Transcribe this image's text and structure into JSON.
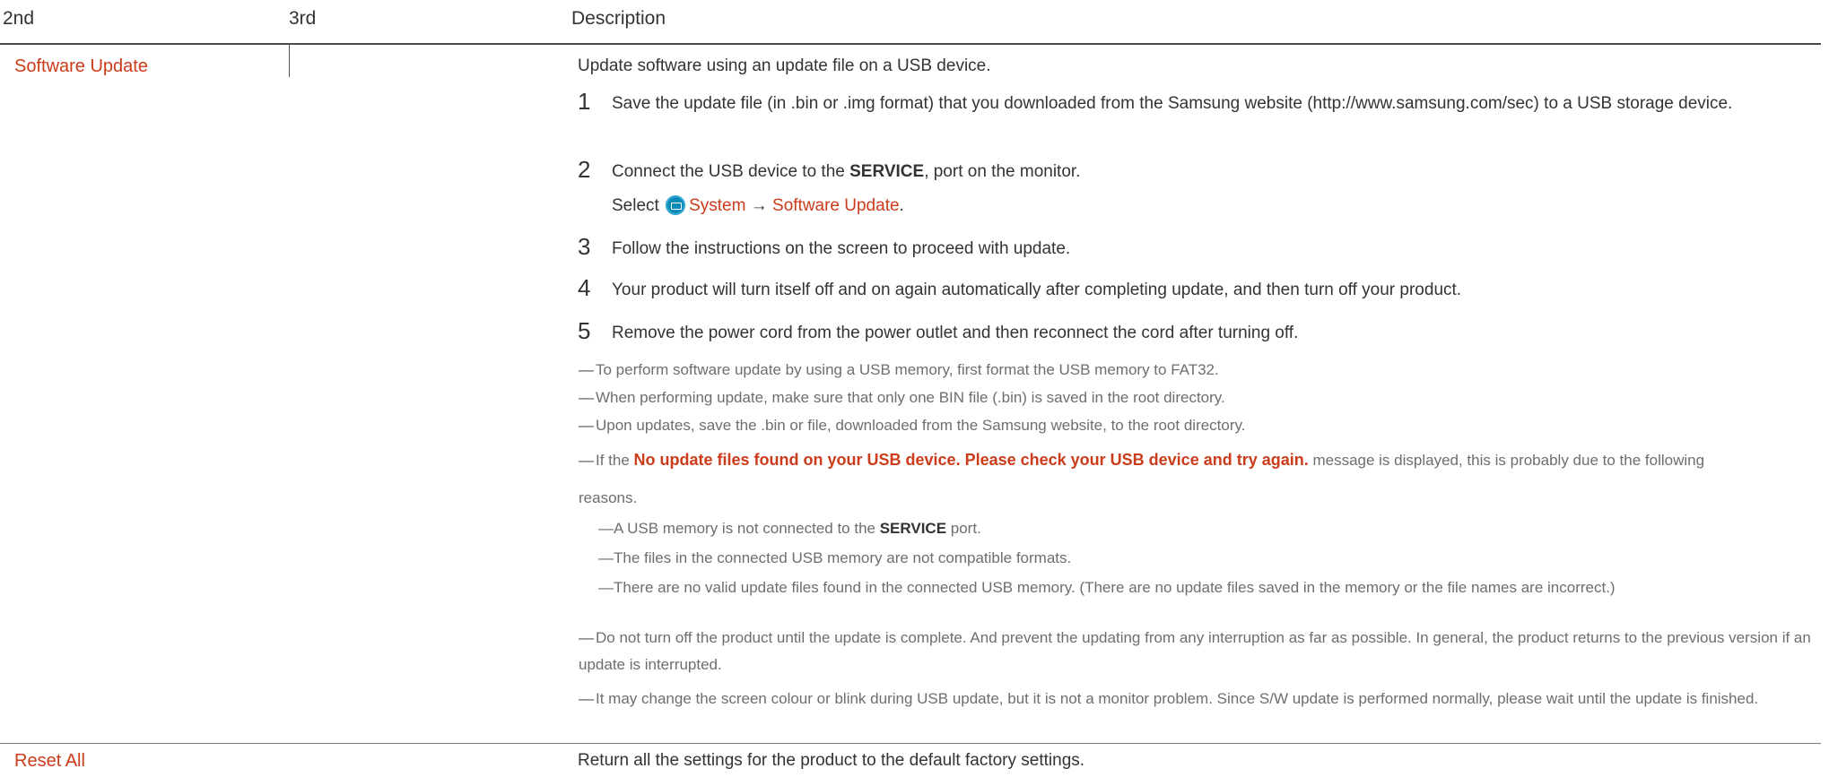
{
  "header": {
    "col1": "2nd",
    "col2": "3rd",
    "col3": "Description"
  },
  "software_update": {
    "name": "Software Update",
    "intro": "Update software using an update file on a USB device.",
    "steps": [
      {
        "num": "1",
        "text": "Save the update file (in .bin or .img format) that you downloaded from the Samsung website (http://www.samsung.com/sec) to a USB storage device."
      },
      {
        "num": "2",
        "text_a": "Connect the USB device to the ",
        "bold": "SERVICE",
        "text_b": ", port on the monitor.",
        "select_label": "Select",
        "menu_system": "System",
        "arrow": "→",
        "menu_update": "Software Update",
        "period": "."
      },
      {
        "num": "3",
        "text": "Follow the instructions on the screen to proceed with update."
      },
      {
        "num": "4",
        "text": "Your product will turn itself off and on again automatically after completing update, and then turn off your product."
      },
      {
        "num": "5",
        "text": "Remove the power cord from the power outlet and then reconnect the cord after turning off."
      }
    ],
    "notes": {
      "dash": "―",
      "n1": "To perform software update by using a USB memory, first format the USB memory to FAT32.",
      "n2": "When performing update, make sure that only one BIN file (.bin) is saved in the root directory.",
      "n3": "Upon updates, save the .bin or file, downloaded from the Samsung website, to the root directory.",
      "n4_a": "If the ",
      "n4_msg": "No update files found on your USB device. Please check your USB device and try again.",
      "n4_b": " message is displayed, this is probably due to the following",
      "n4_c": "reasons.",
      "s1_a": "A USB memory is not connected to the ",
      "s1_bold": "SERVICE",
      "s1_b": " port.",
      "s2": "The files in the connected USB memory are not compatible formats.",
      "s3": "There are no valid update files found in the connected USB memory. (There are no update files saved in the memory or the file names are incorrect.)",
      "n5": "Do not turn off the product until the update is complete. And prevent the updating from any interruption as far as possible. In general, the product returns to the previous version if an update is interrupted.",
      "n6": "It may change the screen colour or blink during USB update, but it is not a monitor problem. Since S/W update is performed normally, please wait until the update is finished."
    }
  },
  "reset_all": {
    "name": "Reset All",
    "desc": "Return all the settings for the product to the default factory settings."
  },
  "colors": {
    "accent": "#cc3b1a",
    "text": "#333333",
    "note": "#6e6e6e",
    "system_icon": "#0a8bb8"
  }
}
